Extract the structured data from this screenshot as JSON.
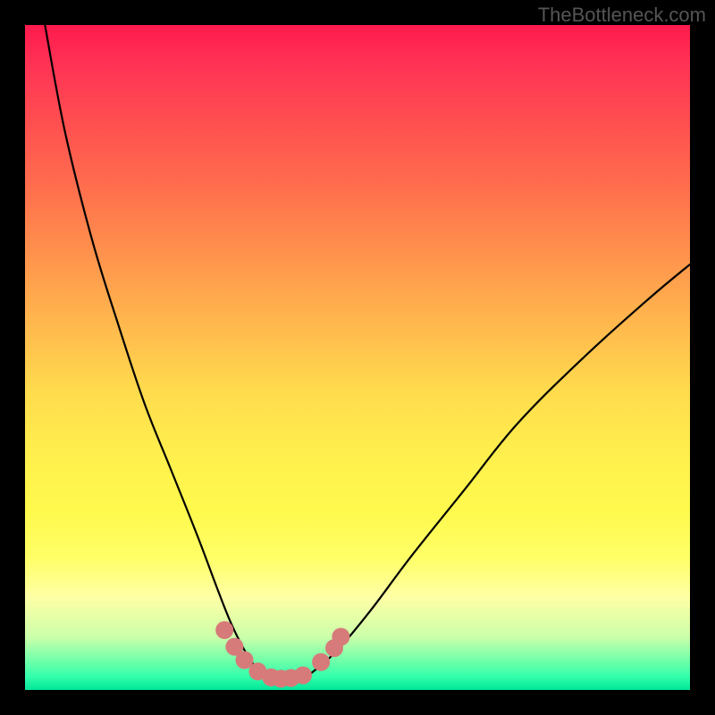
{
  "watermark": "TheBottleneck.com",
  "chart_data": {
    "type": "line",
    "title": "",
    "xlabel": "",
    "ylabel": "",
    "xlim": [
      0,
      100
    ],
    "ylim": [
      0,
      100
    ],
    "series": [
      {
        "name": "bottleneck-curve",
        "x": [
          3,
          6,
          10,
          14,
          18,
          22,
          26,
          29,
          31,
          33,
          35,
          37,
          39,
          41,
          43,
          47,
          52,
          58,
          66,
          74,
          84,
          94,
          100
        ],
        "y": [
          100,
          84,
          68,
          55,
          43,
          33,
          23,
          15,
          10,
          6,
          3,
          1.5,
          1,
          1.2,
          2.5,
          6,
          12,
          20,
          30,
          40,
          50,
          59,
          64
        ]
      }
    ],
    "highlight_points": {
      "name": "pink-dots",
      "x": [
        30,
        31.5,
        33,
        35,
        37,
        38.5,
        40,
        41.8,
        44.5,
        46.5,
        47.5
      ],
      "y": [
        9,
        6.5,
        4.5,
        2.8,
        1.9,
        1.7,
        1.8,
        2.2,
        4.2,
        6.3,
        8
      ]
    }
  }
}
